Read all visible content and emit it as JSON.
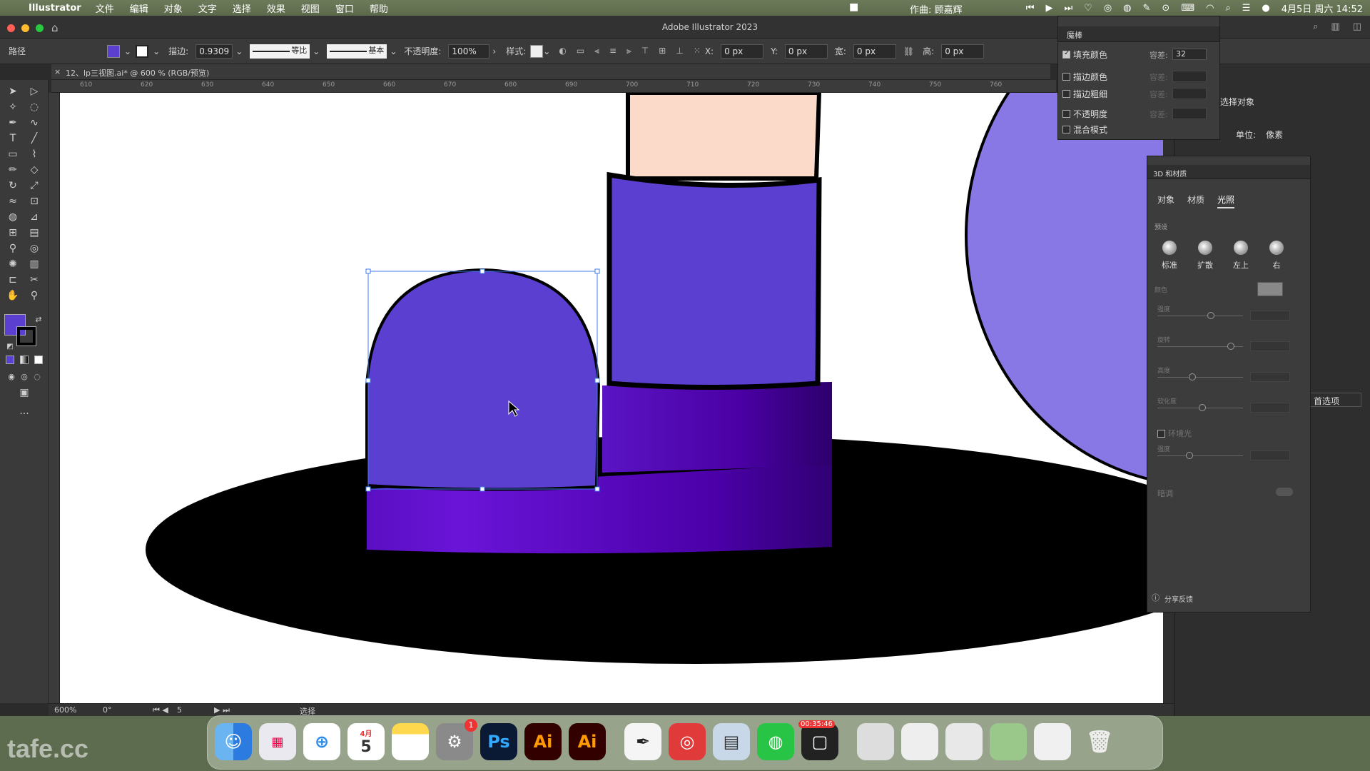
{
  "menubar": {
    "app_name": "Illustrator",
    "items": [
      "文件",
      "编辑",
      "对象",
      "文字",
      "选择",
      "效果",
      "视图",
      "窗口",
      "帮助"
    ],
    "credit": "作曲: 顾嘉辉",
    "datetime": "4月5日 周六 14:52"
  },
  "titlebar": {
    "title": "Adobe Illustrator 2023"
  },
  "controlbar": {
    "object_type": "路径",
    "fill_color": "#5b3fd0",
    "stroke_label": "描边:",
    "stroke_weight": "0.9309",
    "profile_label": "等比",
    "brush_label": "基本",
    "opacity_label": "不透明度:",
    "opacity_value": "100%",
    "style_label": "样式:",
    "x_label": "X:",
    "x_value": "0 px",
    "y_label": "Y:",
    "y_value": "0 px",
    "w_label": "宽:",
    "w_value": "0 px",
    "h_label": "高:",
    "h_value": "0 px"
  },
  "document": {
    "tab_title": "12、lp三视图.ai* @ 600 % (RGB/预览)",
    "ruler_ticks": [
      "610",
      "620",
      "630",
      "640",
      "650",
      "660",
      "670",
      "680",
      "690",
      "700",
      "710",
      "720",
      "730",
      "740",
      "750",
      "760"
    ]
  },
  "statusbar": {
    "zoom": "600%",
    "rotation": "0°",
    "artboard": "5",
    "tool": "选择"
  },
  "magic_wand": {
    "title": "魔棒",
    "rows": [
      {
        "label": "填充颜色",
        "checked": true,
        "tol_label": "容差:",
        "tol_value": "32"
      },
      {
        "label": "描边颜色",
        "checked": false,
        "tol_label": "容差:",
        "tol_value": ""
      },
      {
        "label": "描边粗细",
        "checked": false,
        "tol_label": "容差:",
        "tol_value": ""
      },
      {
        "label": "不透明度",
        "checked": false,
        "tol_label": "容差:",
        "tol_value": ""
      },
      {
        "label": "混合模式",
        "checked": false,
        "tol_label": "",
        "tol_value": ""
      }
    ]
  },
  "panel_3d": {
    "title": "3D 和材质",
    "tabs": [
      "对象",
      "材质",
      "光照"
    ],
    "active_tab": "光照",
    "preset_label": "预设",
    "presets": [
      "标准",
      "扩散",
      "左上",
      "右"
    ],
    "color_label": "颜色",
    "sliders": [
      "强度",
      "旋转",
      "高度",
      "软化度"
    ],
    "ambient_label": "环境光",
    "ambient_strength_label": "强度",
    "shadow_label": "暗调",
    "feedback": "分享反馈"
  },
  "right_dock": {
    "select_object": "选择对象",
    "unit_label": "单位:",
    "unit_value": "像素",
    "prefs_button": "首选项"
  },
  "dock": {
    "calendar_month": "4月",
    "calendar_day": "5",
    "settings_badge": "1",
    "recording_time": "00:35:46"
  },
  "watermark": "tafe.cc"
}
